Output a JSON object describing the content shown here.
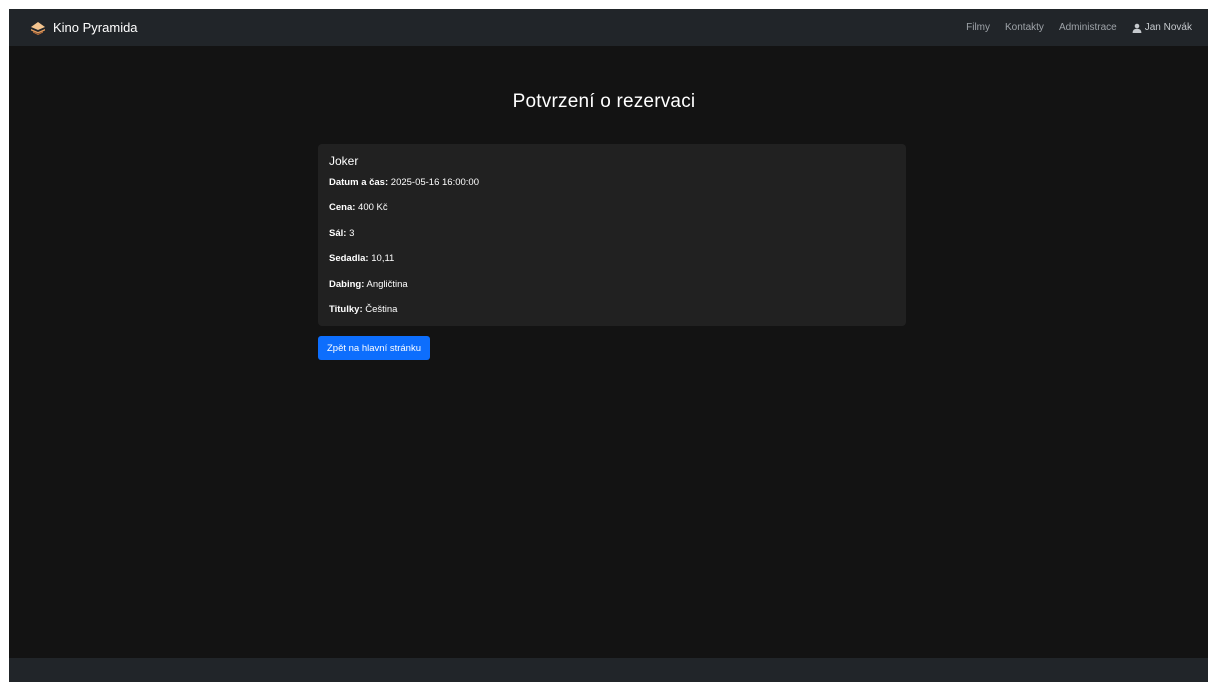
{
  "navbar": {
    "brand": "Kino Pyramida",
    "brand_icon": "pyramid-logo-icon",
    "brand_color": "#e39b5c",
    "links": [
      "Filmy",
      "Kontakty",
      "Administrace"
    ],
    "user": {
      "name": "Jan Novák",
      "icon": "user-icon"
    }
  },
  "page": {
    "title": "Potvrzení o rezervaci"
  },
  "reservation": {
    "movie": "Joker",
    "details": [
      {
        "label": "Datum a čas:",
        "value": "2025-05-16 16:00:00"
      },
      {
        "label": "Cena:",
        "value": "400 Kč"
      },
      {
        "label": "Sál:",
        "value": "3"
      },
      {
        "label": "Sedadla:",
        "value": "10,11"
      },
      {
        "label": "Dabing:",
        "value": "Angličtina"
      },
      {
        "label": "Titulky:",
        "value": "Čeština"
      }
    ]
  },
  "actions": {
    "back_label": "Zpět na hlavní stránku"
  },
  "colors": {
    "background": "#131313",
    "navbar": "#212529",
    "card": "#212121",
    "primary": "#0d6efd"
  }
}
